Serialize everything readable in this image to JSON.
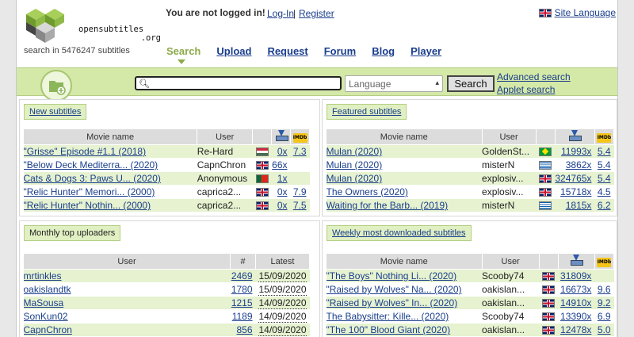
{
  "header": {
    "logo_text_1": "opensubtitles",
    "logo_text_2": ".org",
    "tagline": "search in 5476247 subtitles",
    "login_status": "You are not logged in!",
    "login_link": "Log-In",
    "login_sep": "|",
    "register_link": "Register",
    "site_language": "Site Language"
  },
  "nav": {
    "tabs": [
      {
        "label": "Search",
        "active": true
      },
      {
        "label": "Upload"
      },
      {
        "label": "Request"
      },
      {
        "label": "Forum"
      },
      {
        "label": "Blog"
      },
      {
        "label": "Player"
      }
    ]
  },
  "search": {
    "value": "",
    "language_placeholder": "Language",
    "button": "Search",
    "advanced": "Advanced search",
    "applet": "Applet search"
  },
  "new_subtitles": {
    "title": "New subtitles",
    "headers": [
      "Movie name",
      "User"
    ],
    "rows": [
      {
        "movie": "\"Grisse\" Episode #1.1 (2018)",
        "user": "Re-Hard",
        "flag": "hu",
        "downloads": "0x",
        "rating": "7.3"
      },
      {
        "movie": "\"Below Deck Mediterra... (2020)",
        "user": "CapnChron",
        "flag": "uk",
        "downloads": "66x",
        "rating": ""
      },
      {
        "movie": "Cats & Dogs 3: Paws U... (2020)",
        "user": "Anonymous",
        "flag": "pt",
        "downloads": "1x",
        "rating": ""
      },
      {
        "movie": "\"Relic Hunter\" Memori... (2000)",
        "user": "caprica2...",
        "flag": "uk",
        "downloads": "0x",
        "rating": "7.9"
      },
      {
        "movie": "\"Relic Hunter\" Nothin... (2000)",
        "user": "caprica2...",
        "flag": "uk",
        "downloads": "0x",
        "rating": "7.5"
      }
    ]
  },
  "featured_subtitles": {
    "title": "Featured subtitles",
    "headers": [
      "Movie name",
      "User"
    ],
    "rows": [
      {
        "movie": "Mulan (2020)",
        "user": "GoldenSt...",
        "flag": "br",
        "downloads": "11993x",
        "rating": "5.4"
      },
      {
        "movie": "Mulan (2020)",
        "user": "misterN",
        "flag": "gr",
        "downloads": "3862x",
        "rating": "5.4"
      },
      {
        "movie": "Mulan (2020)",
        "user": "explosiv...",
        "flag": "uk",
        "downloads": "324765x",
        "rating": "5.4"
      },
      {
        "movie": "The Owners (2020)",
        "user": "explosiv...",
        "flag": "uk",
        "downloads": "15718x",
        "rating": "4.5"
      },
      {
        "movie": "Waiting for the Barb... (2019)",
        "user": "misterN",
        "flag": "gr",
        "downloads": "1815x",
        "rating": "6.2"
      }
    ]
  },
  "top_uploaders": {
    "title": "Monthly top uploaders",
    "headers": [
      "User",
      "#",
      "Latest"
    ],
    "rows": [
      {
        "user": "mrtinkles",
        "count": "2469",
        "latest": "15/09/2020"
      },
      {
        "user": "oakislandtk",
        "count": "1780",
        "latest": "15/09/2020"
      },
      {
        "user": "MaSousa",
        "count": "1215",
        "latest": "14/09/2020"
      },
      {
        "user": "SonKun02",
        "count": "1189",
        "latest": "14/09/2020"
      },
      {
        "user": "CapnChron",
        "count": "856",
        "latest": "14/09/2020"
      }
    ]
  },
  "weekly_downloaded": {
    "title": "Weekly most downloaded subtitles",
    "headers": [
      "Movie name",
      "User"
    ],
    "rows": [
      {
        "movie": "\"The Boys\" Nothing Li... (2020)",
        "user": "Scooby74",
        "flag": "uk",
        "downloads": "31809x",
        "rating": ""
      },
      {
        "movie": "\"Raised by Wolves\" Na... (2020)",
        "user": "oakislan...",
        "flag": "uk",
        "downloads": "16673x",
        "rating": "9.6"
      },
      {
        "movie": "\"Raised by Wolves\" In... (2020)",
        "user": "oakislan...",
        "flag": "uk",
        "downloads": "14910x",
        "rating": "9.2"
      },
      {
        "movie": "The Babysitter: Kille... (2020)",
        "user": "Scooby74",
        "flag": "uk",
        "downloads": "13390x",
        "rating": "6.9"
      },
      {
        "movie": "\"The 100\" Blood Giant (2020)",
        "user": "oakislan...",
        "flag": "uk",
        "downloads": "12478x",
        "rating": "5.0"
      }
    ]
  },
  "icons": {
    "download": "download-icon",
    "imdb": "imdb-icon",
    "imdb_text": "IMDb"
  }
}
